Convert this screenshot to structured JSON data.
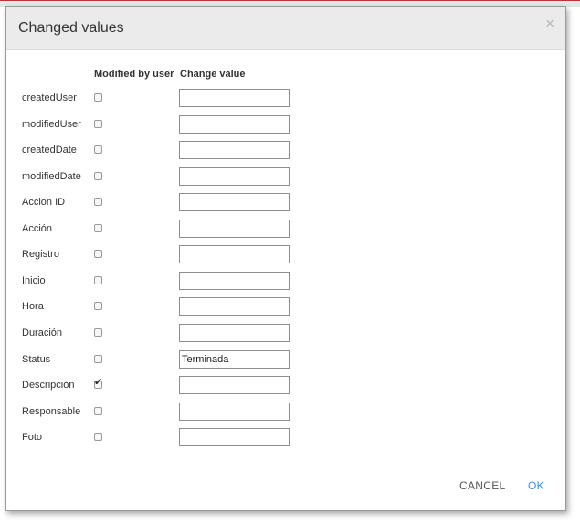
{
  "dialog": {
    "title": "Changed values",
    "close_glyph": "×",
    "col_modified": "Modified by user",
    "col_change": "Change value",
    "rows": [
      {
        "label": "createdUser",
        "checked": false,
        "value": ""
      },
      {
        "label": "modifiedUser",
        "checked": false,
        "value": ""
      },
      {
        "label": "createdDate",
        "checked": false,
        "value": ""
      },
      {
        "label": "modifiedDate",
        "checked": false,
        "value": ""
      },
      {
        "label": "Accion ID",
        "checked": false,
        "value": ""
      },
      {
        "label": "Acción",
        "checked": false,
        "value": ""
      },
      {
        "label": "Registro",
        "checked": false,
        "value": ""
      },
      {
        "label": "Inicio",
        "checked": false,
        "value": ""
      },
      {
        "label": "Hora",
        "checked": false,
        "value": ""
      },
      {
        "label": "Duración",
        "checked": false,
        "value": ""
      },
      {
        "label": "Status",
        "checked": false,
        "value": "Terminada"
      },
      {
        "label": "Descripción",
        "checked": true,
        "value": ""
      },
      {
        "label": "Responsable",
        "checked": false,
        "value": ""
      },
      {
        "label": "Foto",
        "checked": false,
        "value": ""
      }
    ],
    "cancel_label": "CANCEL",
    "ok_label": "OK",
    "colors": {
      "header_bg": "#ebebeb",
      "ok": "#3a8ee6",
      "cancel": "#555555"
    }
  }
}
